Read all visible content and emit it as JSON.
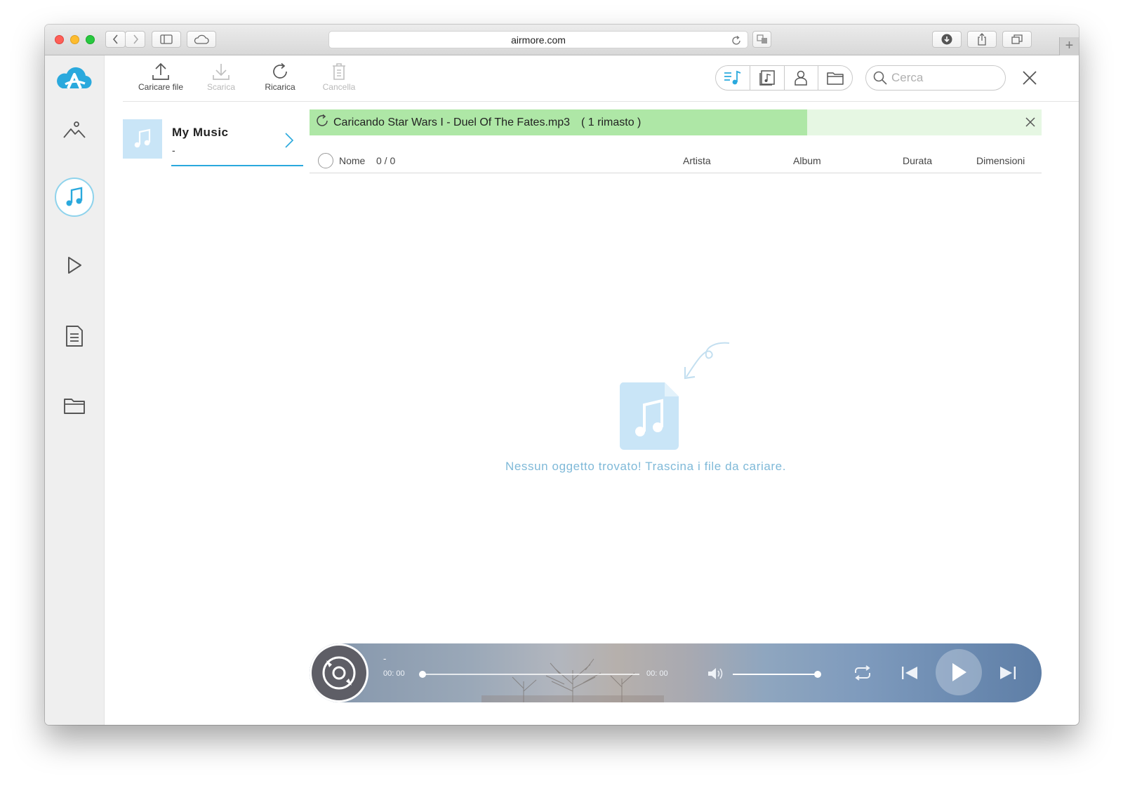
{
  "browser": {
    "url": "airmore.com",
    "new_tab": "+"
  },
  "toolbar": {
    "upload_label": "Caricare file",
    "download_label": "Scarica",
    "reload_label": "Ricarica",
    "delete_label": "Cancella",
    "search_placeholder": "Cerca"
  },
  "album": {
    "title": "My Music",
    "subtitle": "-"
  },
  "upload_banner": {
    "text": "Caricando Star Wars I - Duel Of The Fates.mp3",
    "remaining": "( 1 rimasto )",
    "progress": 0.68
  },
  "table": {
    "name_header": "Nome",
    "count": "0 / 0",
    "artist_header": "Artista",
    "album_header": "Album",
    "duration_header": "Durata",
    "size_header": "Dimensioni"
  },
  "empty_state": {
    "message": "Nessun oggetto trovato! Trascina i file da cariare."
  },
  "player": {
    "track_title": "-",
    "elapsed": "00: 00",
    "total": "00: 00",
    "progress": 0,
    "volume": 1.0
  },
  "colors": {
    "accent": "#2aa9dd",
    "banner_fill": "#aee7a6",
    "banner_bg": "#e6f7e3",
    "empty_text": "#7fb9d8"
  },
  "icons": {
    "sidebar": [
      "photos-icon",
      "music-icon",
      "video-icon",
      "document-icon",
      "folder-icon"
    ],
    "view_switch": [
      "music-list-icon",
      "album-view-icon",
      "artist-icon",
      "folder-icon"
    ]
  }
}
